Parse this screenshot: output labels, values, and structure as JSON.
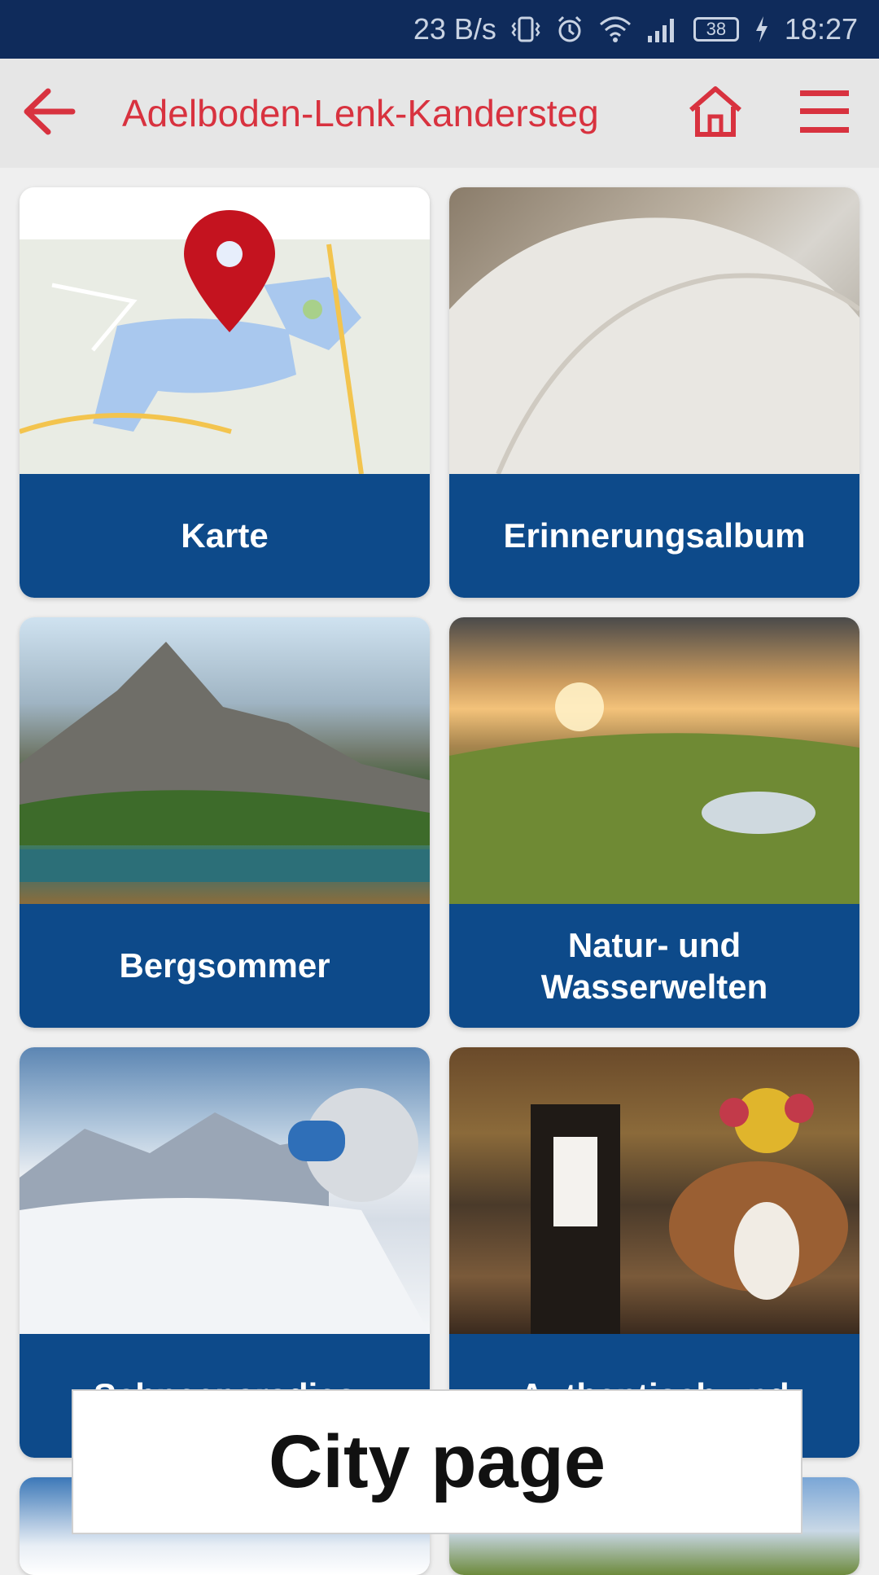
{
  "status_bar": {
    "net_speed": "23 B/s",
    "battery_level": "38",
    "time": "18:27"
  },
  "app_bar": {
    "title": "Adelboden-Lenk-Kandersteg",
    "accent_color": "#d8323f"
  },
  "tiles": [
    {
      "label": "Karte",
      "image": "map-with-pin"
    },
    {
      "label": "Erinnerungsalbum",
      "image": "open-notebook"
    },
    {
      "label": "Bergsommer",
      "image": "mountain-lake"
    },
    {
      "label": "Natur- und Wasserwelten",
      "image": "sunset-valley-lake"
    },
    {
      "label": "Schneeparadies",
      "image": "ski-slope"
    },
    {
      "label": "Authentisch und",
      "image": "alpine-cattle-procession"
    }
  ],
  "overlay": {
    "caption": "City page"
  },
  "colors": {
    "status_bar_bg": "#0f2b5b",
    "tile_label_bg": "#0d4a8a"
  }
}
